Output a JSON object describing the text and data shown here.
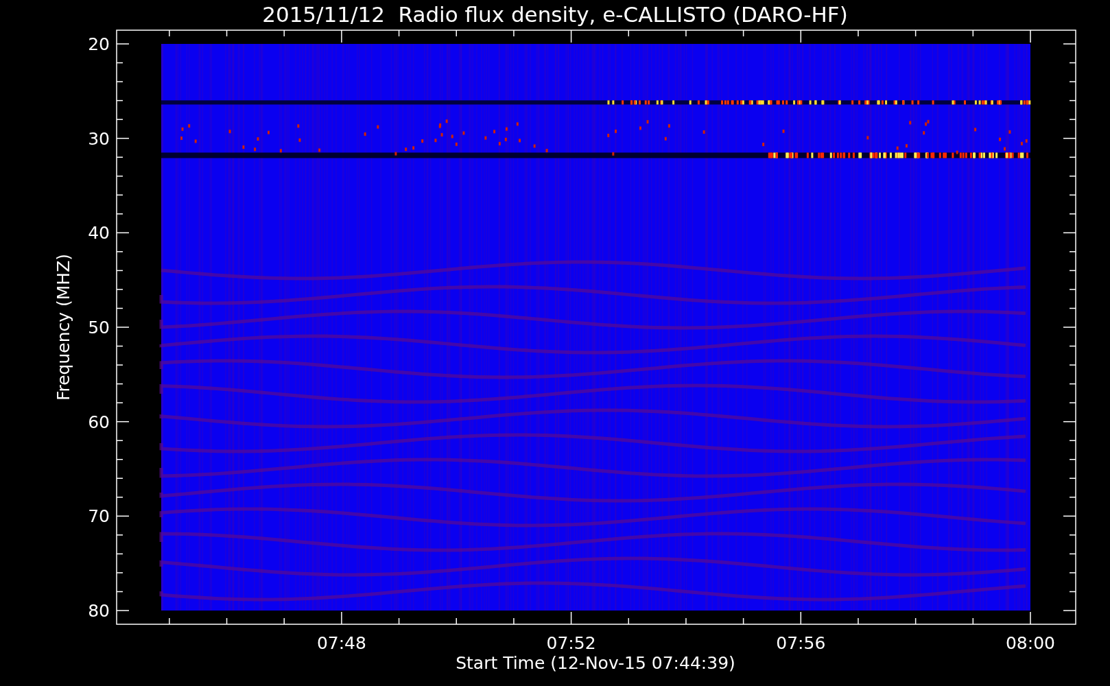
{
  "plot": {
    "title": "2015/11/12  Radio flux density, e-CALLISTO (DARO-HF)",
    "ylabel": "Frequency (MHZ)",
    "xlabel": "Start Time (12-Nov-15 07:44:39)",
    "y_ticks": [
      "20",
      "30",
      "40",
      "50",
      "60",
      "70",
      "80"
    ],
    "x_ticks": [
      "07:48",
      "07:52",
      "07:56",
      "08:00"
    ]
  }
}
